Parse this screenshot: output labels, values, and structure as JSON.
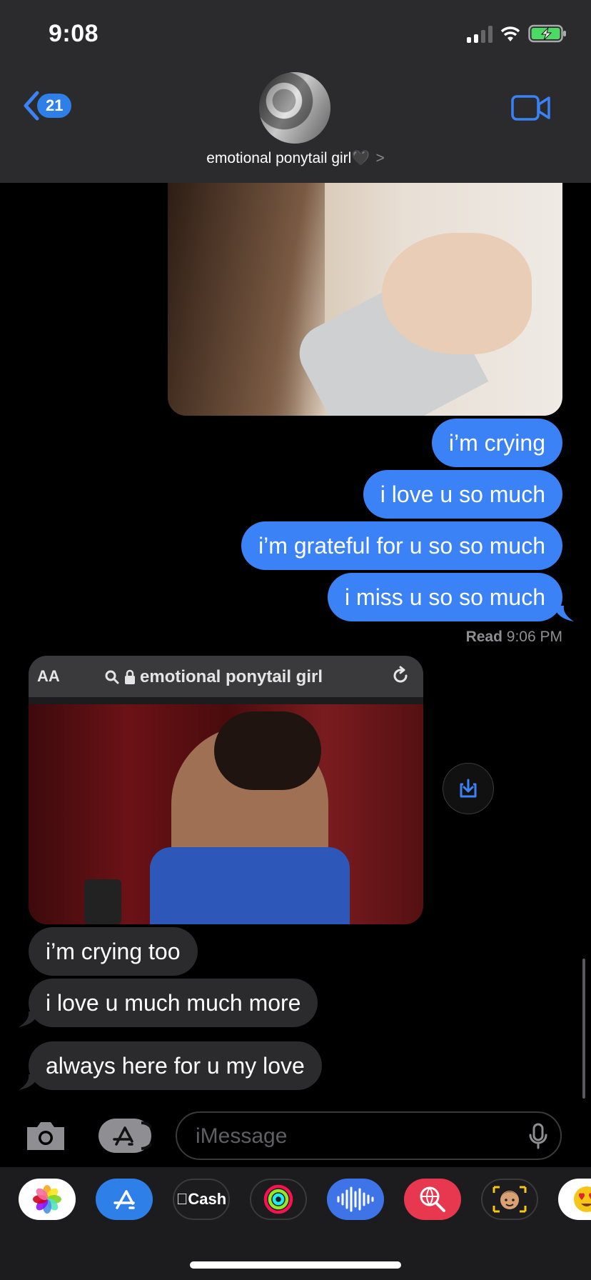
{
  "status_bar": {
    "time": "9:08"
  },
  "header": {
    "back_count": "21",
    "contact_name": "emotional ponytail girl🖤",
    "chevron": ">"
  },
  "messages": {
    "outgoing": [
      "i’m crying",
      "i love u so much",
      "i’m grateful for u so so much",
      "i miss u so so much"
    ],
    "read_label": "Read",
    "read_time": "9:06 PM",
    "link_preview": {
      "aa_label": "AA",
      "url_text": "emotional ponytail girl"
    },
    "incoming": [
      "i’m crying too",
      "i love u much much more",
      "always here for u my love"
    ]
  },
  "compose": {
    "placeholder": "iMessage"
  },
  "app_drawer": {
    "items": [
      {
        "name": "photos",
        "color": "#ffffff"
      },
      {
        "name": "app-store",
        "color": "#2f7fe8"
      },
      {
        "name": "apple-cash",
        "label": "Cash",
        "color": "#1c1c1e"
      },
      {
        "name": "activity",
        "color": "#1c1c1e"
      },
      {
        "name": "shazam",
        "color": "#3f74e8"
      },
      {
        "name": "search-images",
        "color": "#e8384f"
      },
      {
        "name": "memoji",
        "color": "#1c1c1e"
      },
      {
        "name": "animoji",
        "color": "#ffffff"
      }
    ]
  },
  "colors": {
    "accent": "#3b82f6",
    "incoming_bubble": "#2b2b2d",
    "header_bg": "#2b2b2d"
  }
}
